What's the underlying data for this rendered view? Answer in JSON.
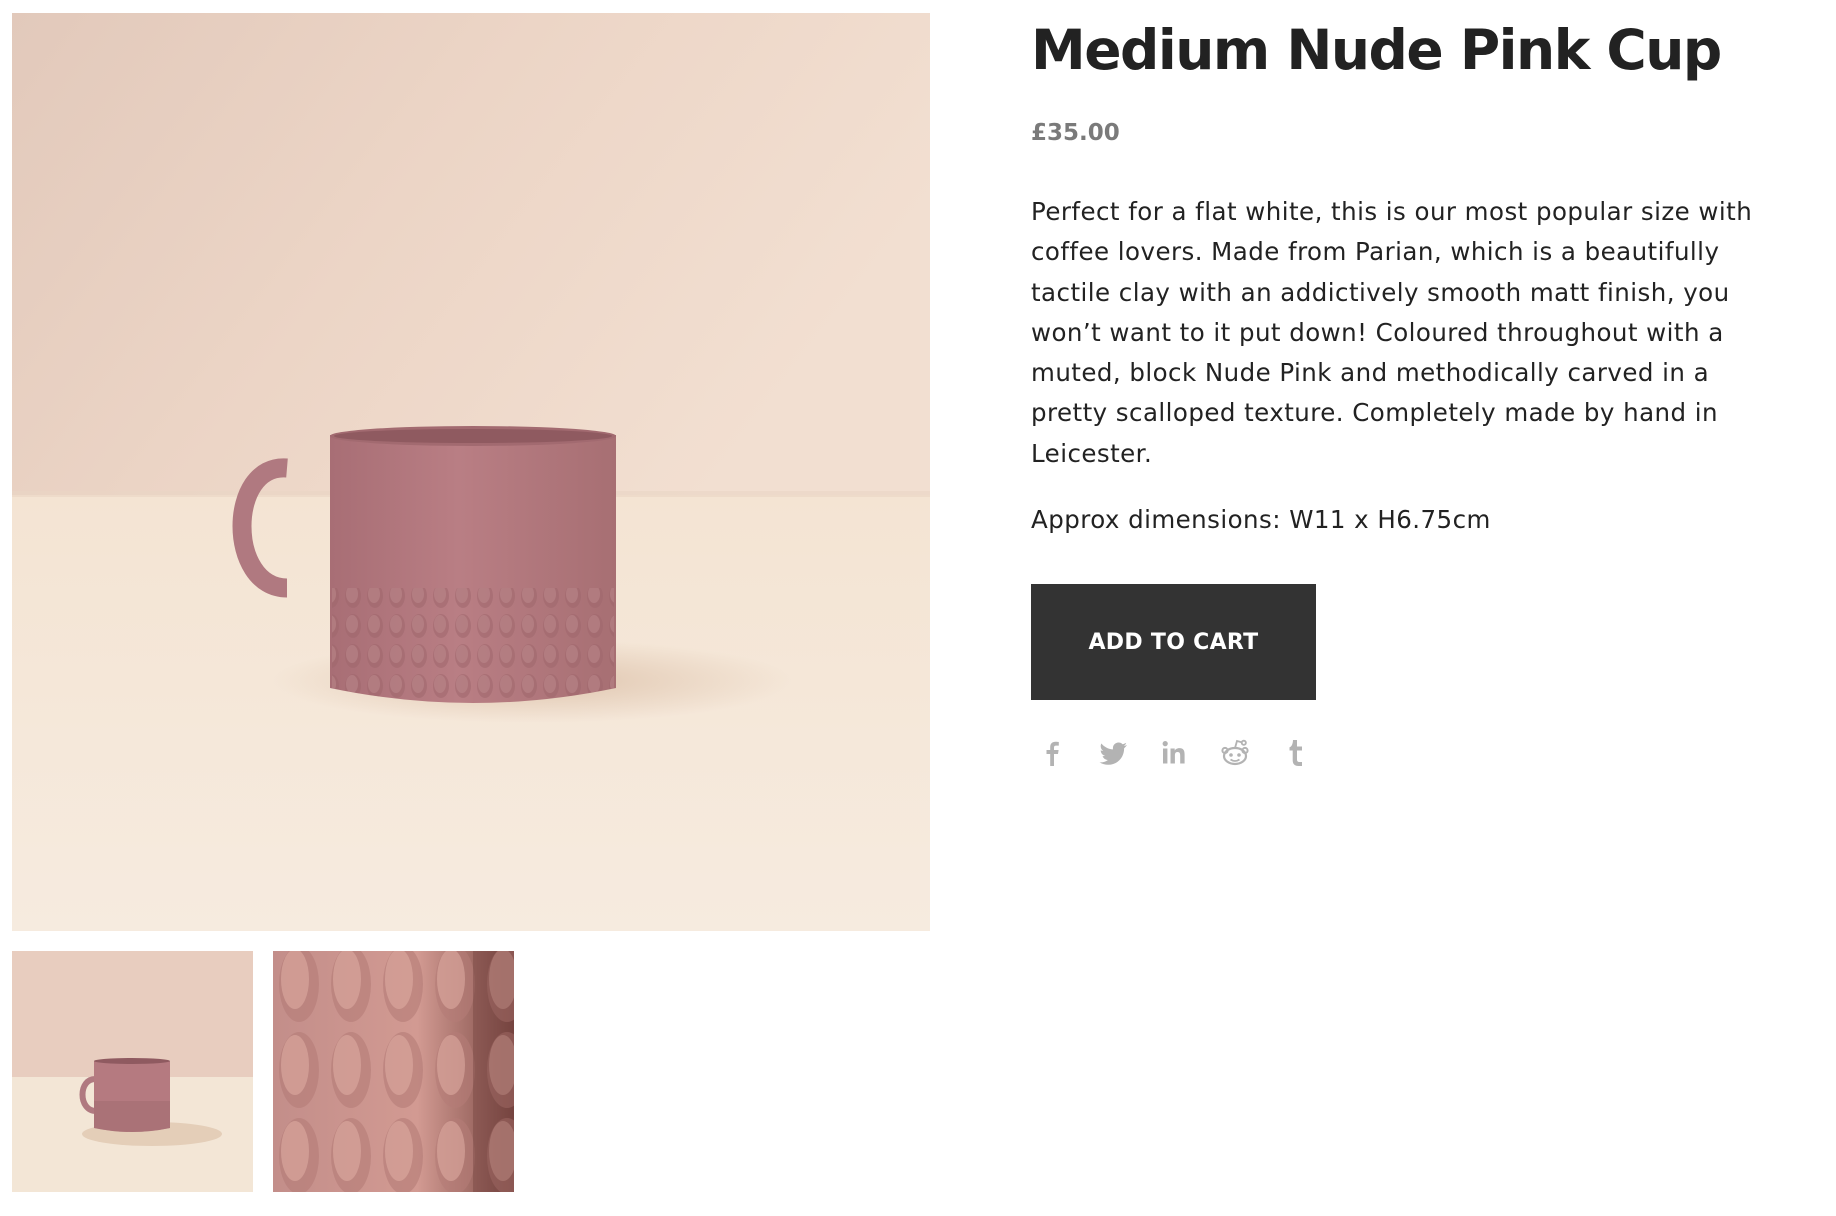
{
  "product": {
    "title": "Medium Nude Pink Cup",
    "price": "£35.00",
    "description": "Perfect for a flat white, this is our most popular size with coffee lovers. Made from Parian, which is a beautifully tactile clay with an addictively smooth matt finish, you won’t want to it put down! Coloured throughout with a muted, block Nude Pink and methodically carved in a pretty scalloped texture. Completely made by hand in Leicester.",
    "dimensions": "Approx dimensions: W11 x H6.75cm",
    "add_to_cart_label": "ADD TO CART"
  },
  "gallery": {
    "main_image": "cup-photo",
    "thumbnails": [
      "cup-photo-thumbnail",
      "texture-closeup-thumbnail"
    ]
  },
  "share": {
    "icons": [
      "facebook-icon",
      "twitter-icon",
      "linkedin-icon",
      "reddit-icon",
      "tumblr-icon"
    ]
  },
  "colors": {
    "button_bg": "#333333",
    "button_text": "#ffffff",
    "price": "#7a7a7a",
    "text": "#222222",
    "share_icons": "#b3b3b3",
    "cup_pink": "#b57a80",
    "wall": "#e8cdbf",
    "table": "#f3e6d6"
  }
}
